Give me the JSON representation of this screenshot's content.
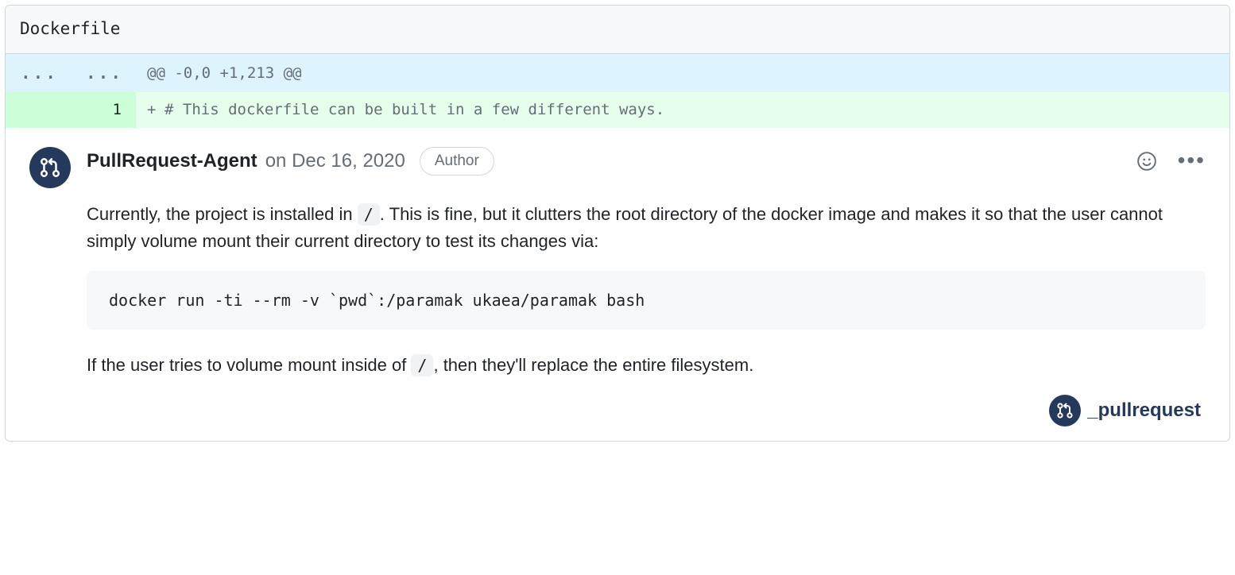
{
  "file": {
    "name": "Dockerfile"
  },
  "diff": {
    "hunk_header": "@@ -0,0 +1,213 @@",
    "line_number": "1",
    "line_prefix": "+",
    "line_content": "# This dockerfile can be built in a few different ways."
  },
  "comment": {
    "username": "PullRequest-Agent",
    "timestamp_prefix": "on ",
    "timestamp": "Dec 16, 2020",
    "badge": "Author",
    "para1_a": "Currently, the project is installed in ",
    "para1_code": "/",
    "para1_b": ". This is fine, but it clutters the root directory of the docker image and makes it so that the user cannot simply volume mount their current directory to test its changes via:",
    "code_block": "docker run -ti --rm -v `pwd`:/paramak ukaea/paramak bash",
    "para2_a": "If the user tries to volume mount inside of ",
    "para2_code": "/",
    "para2_b": ", then they'll replace the entire filesystem."
  },
  "source": {
    "label": "_pullrequest"
  },
  "icons": {
    "gutter_dots": "...",
    "kebab": "•••"
  }
}
